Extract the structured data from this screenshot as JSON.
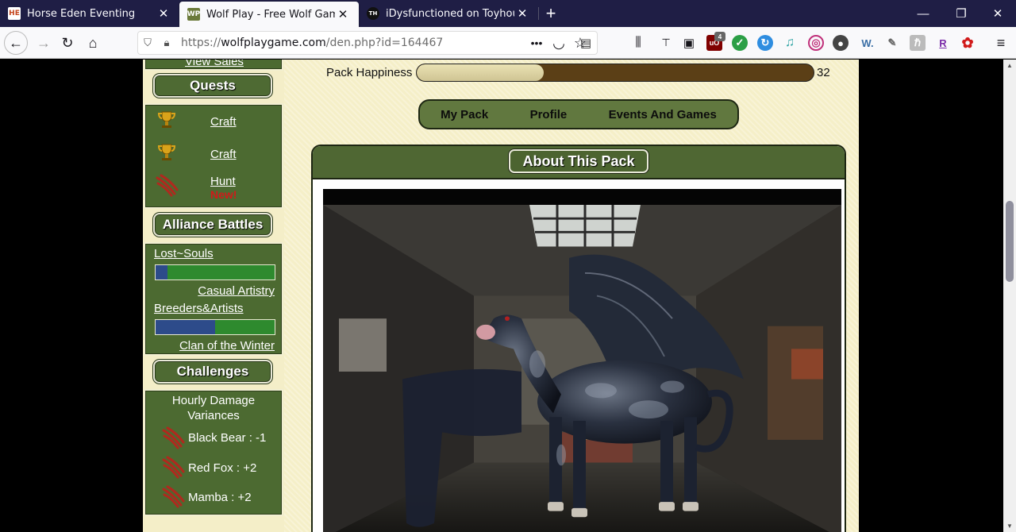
{
  "browser": {
    "tabs": [
      {
        "title": "Horse Eden Eventing",
        "favicon": "HE",
        "favicon_color": "#c4451d"
      },
      {
        "title": "Wolf Play - Free Wolf Game! | W",
        "favicon": "WP",
        "favicon_color": "#6b7a3a"
      },
      {
        "title": "iDysfunctioned on Toyhouse",
        "favicon": "TH",
        "favicon_color": "#111111"
      }
    ],
    "new_tab_label": "+",
    "url_prefix": "https://",
    "url_host": "wolfplaygame.com",
    "url_path": "/den.php?id=164467",
    "ublock_count": "4",
    "ext_w": "W.",
    "ext_r": "R"
  },
  "sidebar": {
    "view_sales": "View Sales",
    "quests_label": "Quests",
    "quests": [
      {
        "label": "Craft",
        "icon": "trophy-icon"
      },
      {
        "label": "Craft",
        "icon": "trophy-icon"
      },
      {
        "label": "Hunt",
        "badge": "New!",
        "icon": "claw-icon"
      }
    ],
    "alliance_label": "Alliance Battles",
    "battles": [
      {
        "left": "Lost~Souls",
        "right": "Casual Artistry",
        "ratio": 0.1
      },
      {
        "left": "Breeders&Artists",
        "right": "Clan of the Winter",
        "ratio": 0.5
      }
    ],
    "challenges_label": "Challenges",
    "damage_title": "Hourly Damage Variances",
    "damage": [
      {
        "label": "Black Bear : -1"
      },
      {
        "label": "Red Fox : +2"
      },
      {
        "label": "Mamba : +2"
      }
    ]
  },
  "main": {
    "happiness_label": "Pack Happiness",
    "happiness_value": "32",
    "happiness_fraction": 0.32,
    "tabs": [
      "My Pack",
      "Profile",
      "Events And Games"
    ],
    "about_title": "About This Pack"
  },
  "colors": {
    "sidebar_green": "#4c6a31",
    "page_cream": "#f5efc8",
    "battle_blue": "#2d4b8a",
    "battle_green": "#2e8a2e",
    "happiness_brown": "#5b3f16",
    "new_red": "#d11a1a"
  }
}
